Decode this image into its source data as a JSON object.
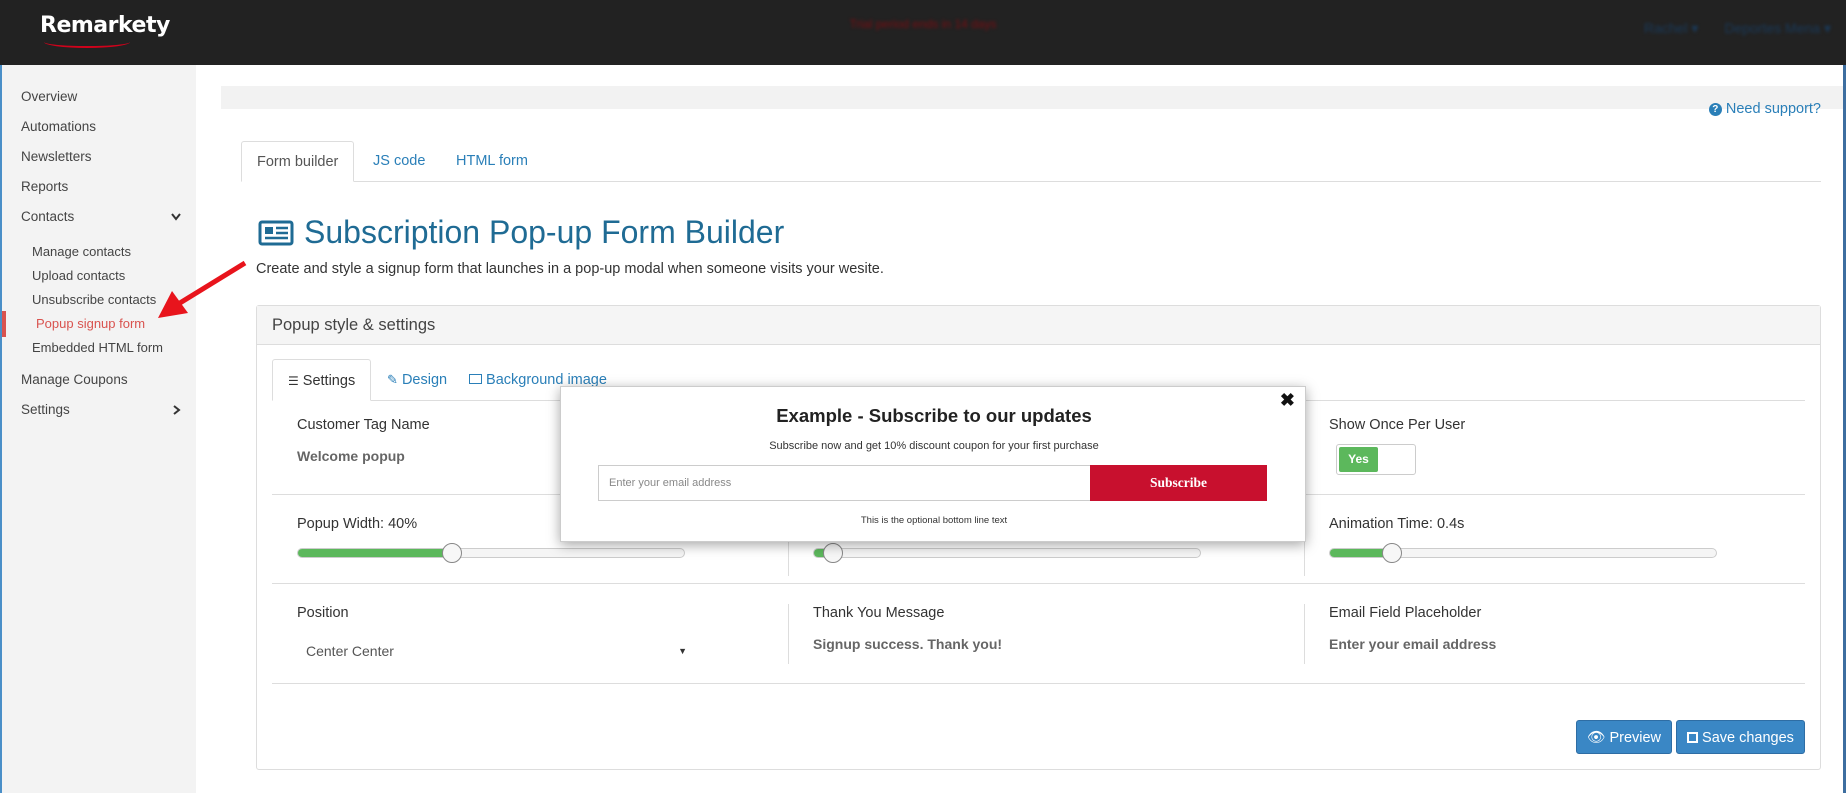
{
  "header": {
    "logo": "Remarkety",
    "trial_notice": "Trial period ends in 14 days",
    "user_menu": "Rachel ▾",
    "store_menu": "Deportes Mena ▾"
  },
  "sidebar": {
    "items": [
      {
        "label": "Overview"
      },
      {
        "label": "Automations"
      },
      {
        "label": "Newsletters"
      },
      {
        "label": "Reports"
      },
      {
        "label": "Contacts"
      },
      {
        "label": "Manage Coupons"
      },
      {
        "label": "Settings"
      }
    ],
    "contacts_sub": [
      {
        "label": "Manage contacts"
      },
      {
        "label": "Upload contacts"
      },
      {
        "label": "Unsubscribe contacts"
      },
      {
        "label": "Popup signup form"
      },
      {
        "label": "Embedded HTML form"
      }
    ]
  },
  "support_link": "Need support?",
  "tabs": [
    {
      "label": "Form builder"
    },
    {
      "label": "JS code"
    },
    {
      "label": "HTML form"
    }
  ],
  "page": {
    "title": "Subscription Pop-up Form Builder",
    "description": "Create and style a signup form that launches in a pop-up modal when someone visits your wesite."
  },
  "panel": {
    "heading": "Popup style & settings",
    "subtabs": [
      {
        "label": "Settings"
      },
      {
        "label": "Design"
      },
      {
        "label": "Background image"
      }
    ],
    "fields": {
      "customer_tag_label": "Customer Tag Name",
      "customer_tag_value": "Welcome popup",
      "show_once_label": "Show Once Per User",
      "show_once_value": "Yes",
      "popup_width_label": "Popup Width: 40%",
      "popup_width_value": 40,
      "middle_slider_value": 5,
      "animation_label": "Animation Time: 0.4s",
      "animation_value": 16,
      "position_label": "Position",
      "position_value": "Center Center",
      "thankyou_label": "Thank You Message",
      "thankyou_value": "Signup success. Thank you!",
      "email_placeholder_label": "Email Field Placeholder",
      "email_placeholder_value": "Enter your email address"
    },
    "buttons": {
      "preview": "Preview",
      "save": "Save changes"
    }
  },
  "popup_preview": {
    "title": "Example - Subscribe to our updates",
    "subtitle": "Subscribe now and get 10% discount coupon for your first purchase",
    "email_placeholder": "Enter your email address",
    "button": "Subscribe",
    "footer": "This is the optional bottom line text",
    "button_color": "#c8102e"
  },
  "colors": {
    "accent": "#2a7fb8",
    "active_nav": "#d9534f",
    "success": "#5cb85c"
  }
}
